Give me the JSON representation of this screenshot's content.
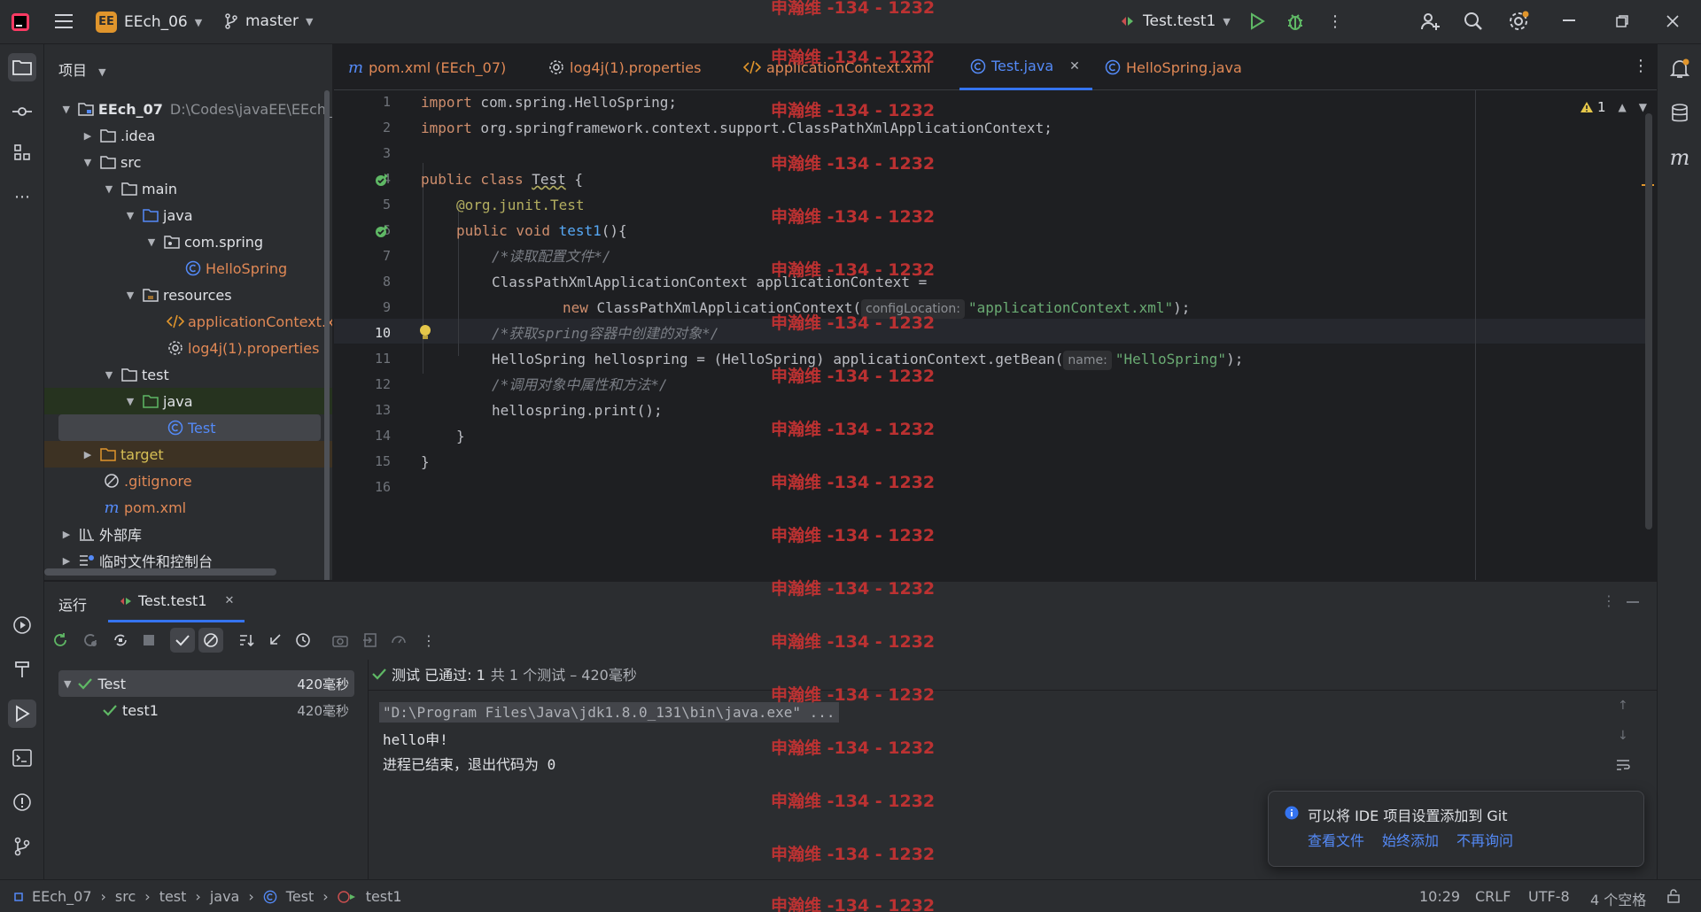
{
  "titlebar": {
    "project_badge": "EE",
    "project_name": "EEch_06",
    "branch": "master",
    "run_config": "Test.test1"
  },
  "project_panel": {
    "title": "项目",
    "root_name": "EEch_07",
    "root_path": "D:\\Codes\\javaEE\\EEch_",
    "items": [
      {
        "label": ".idea"
      },
      {
        "label": "src"
      },
      {
        "label": "main"
      },
      {
        "label": "java"
      },
      {
        "label": "com.spring"
      },
      {
        "label": "HelloSpring"
      },
      {
        "label": "resources"
      },
      {
        "label": "applicationContext.xı"
      },
      {
        "label": "log4j(1).properties"
      },
      {
        "label": "test"
      },
      {
        "label": "java"
      },
      {
        "label": "Test"
      },
      {
        "label": "target"
      },
      {
        "label": ".gitignore"
      },
      {
        "label": "pom.xml"
      },
      {
        "label": "外部库"
      },
      {
        "label": "临时文件和控制台"
      }
    ]
  },
  "editor_tabs": [
    {
      "label": "pom.xml (EEch_07)"
    },
    {
      "label": "log4j(1).properties"
    },
    {
      "label": "applicationContext.xml"
    },
    {
      "label": "Test.java"
    },
    {
      "label": "HelloSpring.java"
    }
  ],
  "editor": {
    "warning_count": "1",
    "line_numbers": [
      "1",
      "2",
      "3",
      "4",
      "5",
      "6",
      "7",
      "8",
      "9",
      "10",
      "11",
      "12",
      "13",
      "14",
      "15",
      "16"
    ],
    "lines": {
      "l1a": "import",
      "l1b": " com.spring.HelloSpring;",
      "l2a": "import",
      "l2b": " org.springframework.context.support.ClassPathXmlApplicationContext;",
      "l4a": "public class",
      "l4b": "Test",
      "l4c": " {",
      "l5a": "@org.junit.",
      "l5b": "Test",
      "l6a": "public void",
      "l6b": "test1",
      "l6c": "(){",
      "l7": "/*读取配置文件*/",
      "l8": "ClassPathXmlApplicationContext applicationContext =",
      "l9a": "new",
      "l9b": " ClassPathXmlApplicationContext(",
      "l9hint": "configLocation:",
      "l9str": "\"applicationContext.xml\"",
      "l9end": ");",
      "l10": "/*获取spring容器中创建的对象*/",
      "l11a": "HelloSpring hellospring = (HelloSpring) applicationContext.getBean(",
      "l11hint": "name:",
      "l11str": "\"HelloSpring\"",
      "l11end": ");",
      "l12": "/*调用对象中属性和方法*/",
      "l13": "hellospring.print();",
      "l14": "}",
      "l15": "}"
    }
  },
  "run_panel": {
    "title": "运行",
    "tab": "Test.test1",
    "tree": [
      {
        "label": "Test",
        "time": "420毫秒"
      },
      {
        "label": "test1",
        "time": "420毫秒"
      }
    ],
    "status_prefix": "测试 已通过: 1",
    "status_suffix": "共 1 个测试 – 420毫秒",
    "console": [
      "\"D:\\Program Files\\Java\\jdk1.8.0_131\\bin\\java.exe\" ...",
      "hello申!",
      "进程已结束，退出代码为 0"
    ]
  },
  "notification": {
    "message": "可以将 IDE 项目设置添加到 Git",
    "actions": [
      "查看文件",
      "始终添加",
      "不再询问"
    ]
  },
  "statusbar": {
    "breadcrumb": [
      "EEch_07",
      "src",
      "test",
      "java",
      "Test",
      "test1"
    ],
    "position": "10:29",
    "line_ending": "CRLF",
    "encoding": "UTF-8",
    "indent": "4 个空格"
  },
  "watermark": "申瀚维 -134 - 1232"
}
